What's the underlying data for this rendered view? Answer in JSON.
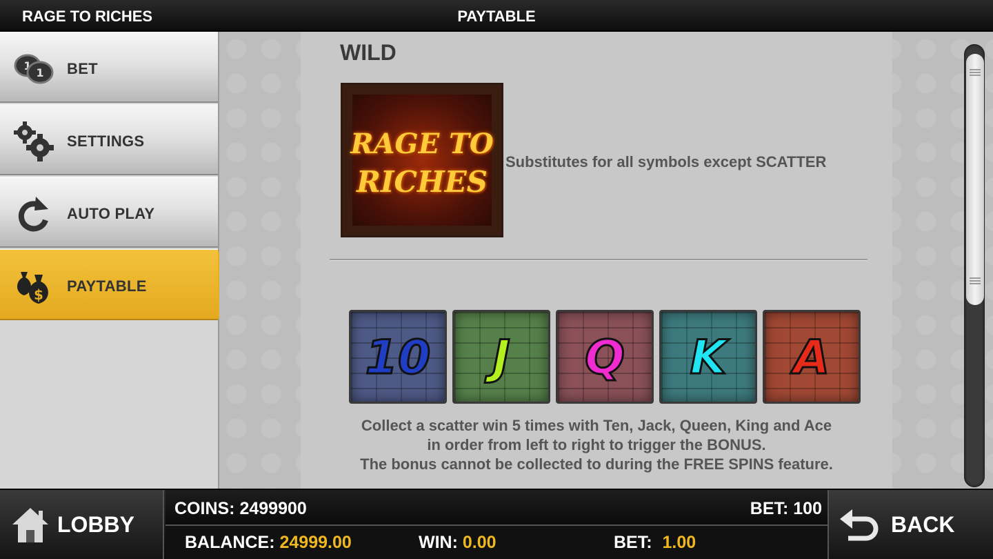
{
  "header": {
    "app_title": "RAGE TO RICHES",
    "page_title": "PAYTABLE"
  },
  "sidebar": {
    "items": [
      {
        "label": "BET",
        "icon": "coins-icon",
        "active": false
      },
      {
        "label": "SETTINGS",
        "icon": "gears-icon",
        "active": false
      },
      {
        "label": "AUTO PLAY",
        "icon": "refresh-icon",
        "active": false
      },
      {
        "label": "PAYTABLE",
        "icon": "money-bags-icon",
        "active": true
      }
    ]
  },
  "paytable": {
    "wild_title": "WILD",
    "wild_logo_line1": "RAGE TO",
    "wild_logo_line2": "RICHES",
    "wild_description": "Substitutes for all symbols except SCATTER",
    "symbols": [
      {
        "glyph": "10",
        "name": "ten-symbol"
      },
      {
        "glyph": "J",
        "name": "jack-symbol"
      },
      {
        "glyph": "Q",
        "name": "queen-symbol"
      },
      {
        "glyph": "K",
        "name": "king-symbol"
      },
      {
        "glyph": "A",
        "name": "ace-symbol"
      }
    ],
    "bonus_line1": "Collect a scatter win 5 times with Ten, Jack, Queen, King and Ace",
    "bonus_line2": "in order from left to right to trigger the BONUS.",
    "bonus_line3": "The bonus cannot be collected to during the FREE SPINS feature."
  },
  "footer": {
    "lobby_label": "LOBBY",
    "back_label": "BACK",
    "coins_label": "COINS:",
    "coins_value": "2499900",
    "bet_coins_label": "BET:",
    "bet_coins_value": "100",
    "balance_label": "BALANCE:",
    "balance_value": "24999.00",
    "win_label": "WIN:",
    "win_value": "0.00",
    "bet_label": "BET:",
    "bet_value": "1.00"
  },
  "colors": {
    "accent": "#e6ad23",
    "value_yellow": "#f0b820",
    "menu_gray": "#d6d6d6"
  }
}
